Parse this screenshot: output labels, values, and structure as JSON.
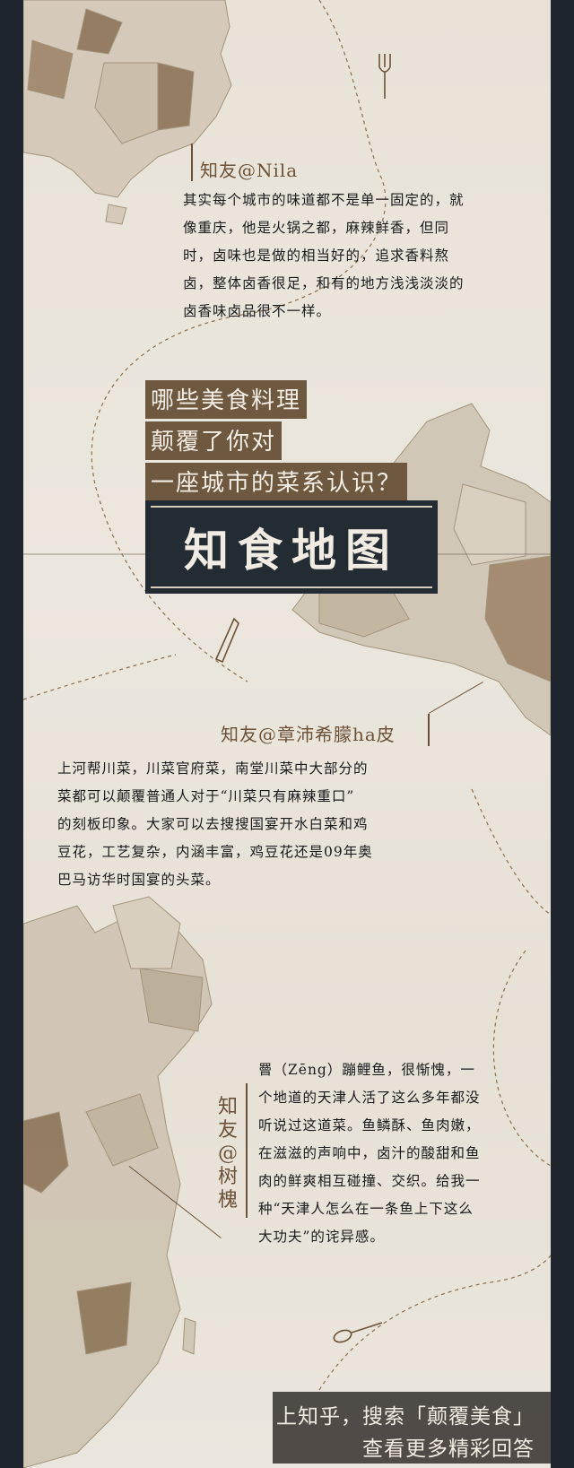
{
  "blocks": [
    {
      "author": "知友@Nila",
      "lines": [
        "其实每个城市的味道都不是单一固定的，就",
        "像重庆，他是火锅之都，麻辣鲜香，但同",
        "时，卤味也是做的相当好的，追求香料熬",
        "卤，整体卤香很足，和有的地方浅浅淡淡的",
        "卤香味卤品很不一样。"
      ]
    },
    {
      "author": "知友@章沛希朦ha皮",
      "lines": [
        "上河帮川菜，川菜官府菜，南堂川菜中大部分的",
        "菜都可以颠覆普通人对于“川菜只有麻辣重口”",
        "的刻板印象。大家可以去搜搜国宴开水白菜和鸡",
        "豆花，工艺复杂，内涵丰富，鸡豆花还是09年奥",
        "巴马访华时国宴的头菜。"
      ]
    },
    {
      "author_chars": [
        "知",
        "友",
        "@",
        "树",
        "槐"
      ],
      "lines": [
        "罾（Zēng）蹦鲤鱼，很惭愧，一",
        "个地道的天津人活了这么多年都没",
        "听说过这道菜。鱼鳞酥、鱼肉嫩，",
        "在滋滋的声响中，卤汁的酸甜和鱼",
        "肉的鲜爽相互碰撞、交织。给我一",
        "种“天津人怎么在一条鱼上下这么",
        "大功夫”的诧异感。"
      ]
    }
  ],
  "headline": [
    "哪些美食料理",
    "颠覆了你对",
    "一座城市的菜系认识？"
  ],
  "brand": "知食地图",
  "cta": [
    "上知乎，搜索「颠覆美食」",
    "查看更多精彩回答"
  ],
  "colors": {
    "background": "#1e252c",
    "paper": "#e8e2d7",
    "map_fill": "#cfc4b2",
    "map_dark": "#8b7356",
    "accent_brown": "#6f5840",
    "brand_box": "#232b33"
  }
}
